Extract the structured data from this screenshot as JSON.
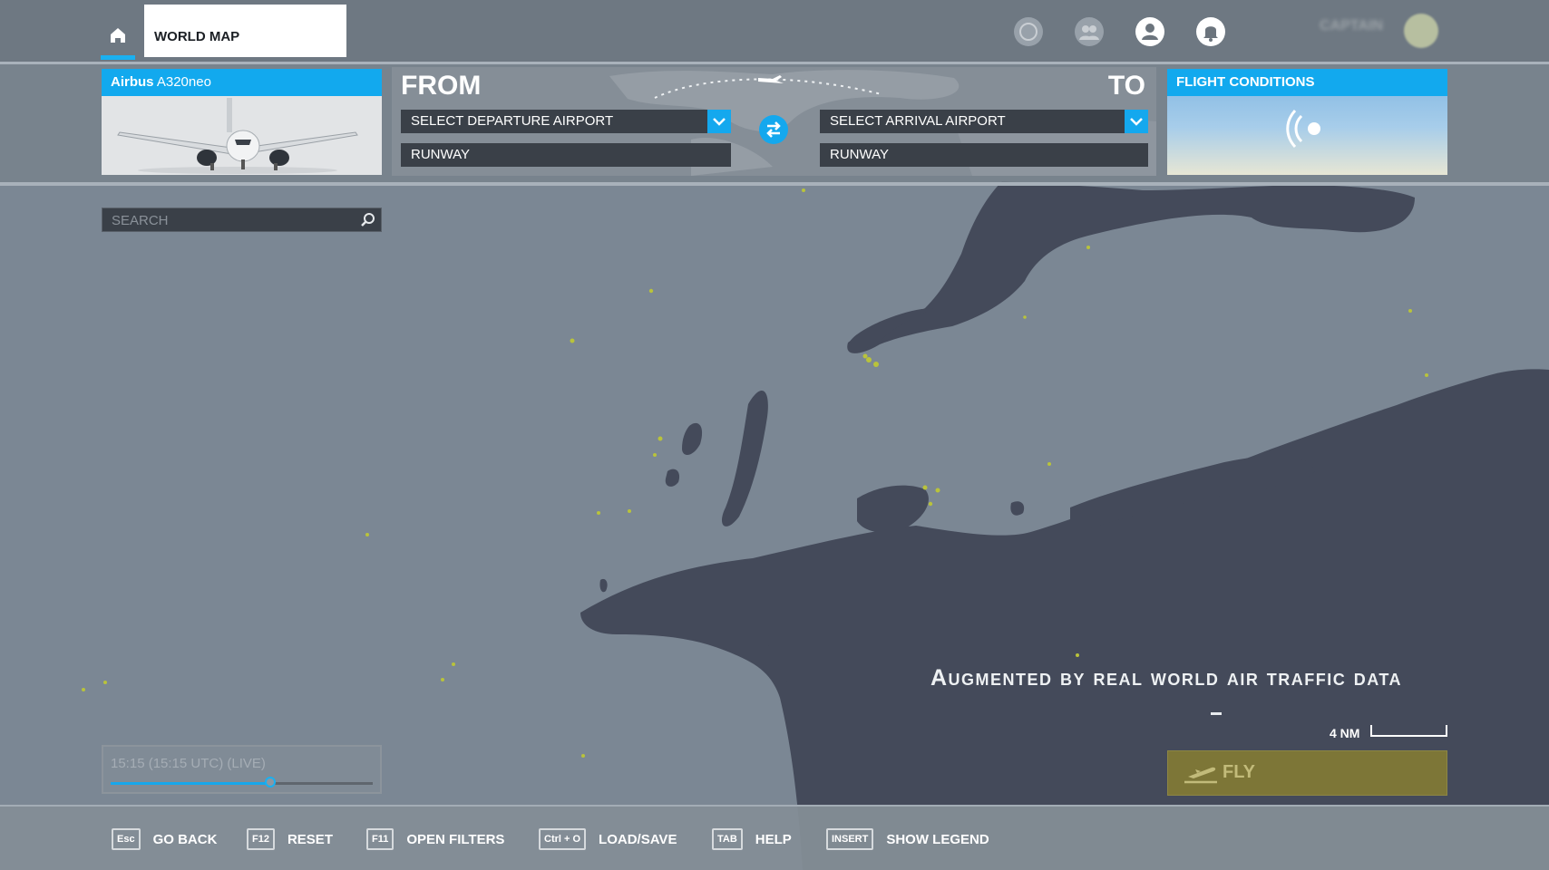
{
  "topbar": {
    "home_icon": "home-icon",
    "world_map_tab": "WORLD MAP",
    "icons": [
      "compass-icon",
      "community-icon",
      "profile-icon",
      "notifications-icon"
    ],
    "pilot_name": "CAPTAIN"
  },
  "aircraft": {
    "make": "Airbus",
    "model": "A320neo",
    "image": "airplane-image"
  },
  "route": {
    "from_label": "FROM",
    "to_label": "TO",
    "departure_placeholder": "SELECT DEPARTURE AIRPORT",
    "arrival_placeholder": "SELECT ARRIVAL AIRPORT",
    "departure_runway": "RUNWAY",
    "arrival_runway": "RUNWAY",
    "swap_icon": "swap-arrows-icon"
  },
  "conditions": {
    "title": "FLIGHT CONDITIONS",
    "icon": "live-weather-icon"
  },
  "search": {
    "placeholder": "SEARCH"
  },
  "map": {
    "tagline": "Augmented by real world air traffic data",
    "scale_label": "4 NM"
  },
  "time": {
    "text": "15:15 (15:15 UTC) (LIVE)",
    "slider_fraction": 0.61
  },
  "fly": {
    "label": "FLY",
    "icon": "takeoff-icon"
  },
  "footer": {
    "keys": [
      {
        "key": "Esc",
        "label": "GO BACK"
      },
      {
        "key": "F12",
        "label": "RESET"
      },
      {
        "key": "F11",
        "label": "OPEN FILTERS"
      },
      {
        "key": "Ctrl + O",
        "label": "LOAD/SAVE"
      },
      {
        "key": "TAB",
        "label": "HELP"
      },
      {
        "key": "INSERT",
        "label": "SHOW LEGEND"
      }
    ]
  },
  "colors": {
    "accent": "#14a8ee",
    "land": "#444a5a",
    "water": "#7b8794",
    "fly": "#7d7637",
    "traffic": "#b9c33b"
  }
}
